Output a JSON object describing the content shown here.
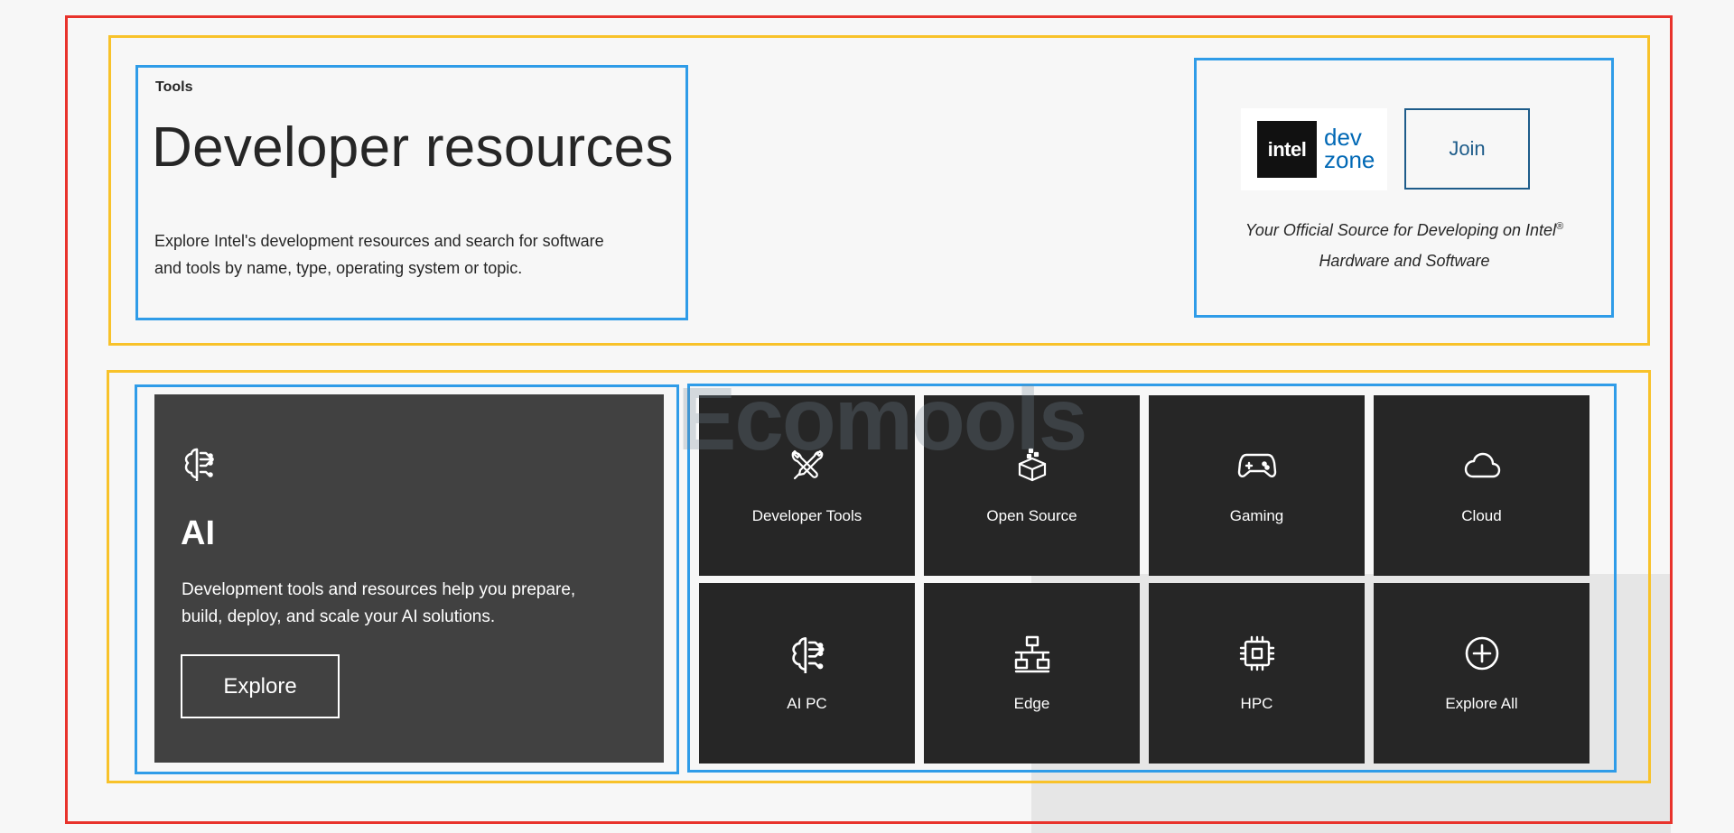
{
  "header": {
    "eyebrow": "Tools",
    "title": "Developer resources",
    "description": "Explore Intel's development resources and search for software and tools by name, type, operating system or topic."
  },
  "devzone": {
    "logo_brand": "intel",
    "logo_dev": "dev",
    "logo_zone": "zone",
    "join_label": "Join",
    "tagline_line1": "Your Official Source for Developing on Intel",
    "tagline_reg": "®",
    "tagline_line2": "Hardware and Software"
  },
  "feature": {
    "icon": "ai-brain-icon",
    "title": "AI",
    "description": "Development tools and resources help you prepare, build, deploy, and scale your AI solutions.",
    "button_label": "Explore"
  },
  "tiles": [
    {
      "label": "Developer Tools",
      "icon": "tools-icon"
    },
    {
      "label": "Open Source",
      "icon": "open-box-icon"
    },
    {
      "label": "Gaming",
      "icon": "gamepad-icon"
    },
    {
      "label": "Cloud",
      "icon": "cloud-icon"
    },
    {
      "label": "AI PC",
      "icon": "ai-brain-icon"
    },
    {
      "label": "Edge",
      "icon": "network-icon"
    },
    {
      "label": "HPC",
      "icon": "chip-icon"
    },
    {
      "label": "Explore All",
      "icon": "plus-circle-icon"
    }
  ],
  "watermark": "Ecomools",
  "colors": {
    "annotation_red": "#e8332c",
    "annotation_yellow": "#f8c22a",
    "annotation_blue": "#2f9ce8",
    "intel_blue": "#0068b5",
    "tile_bg": "#262626",
    "feature_bg": "#414141"
  }
}
